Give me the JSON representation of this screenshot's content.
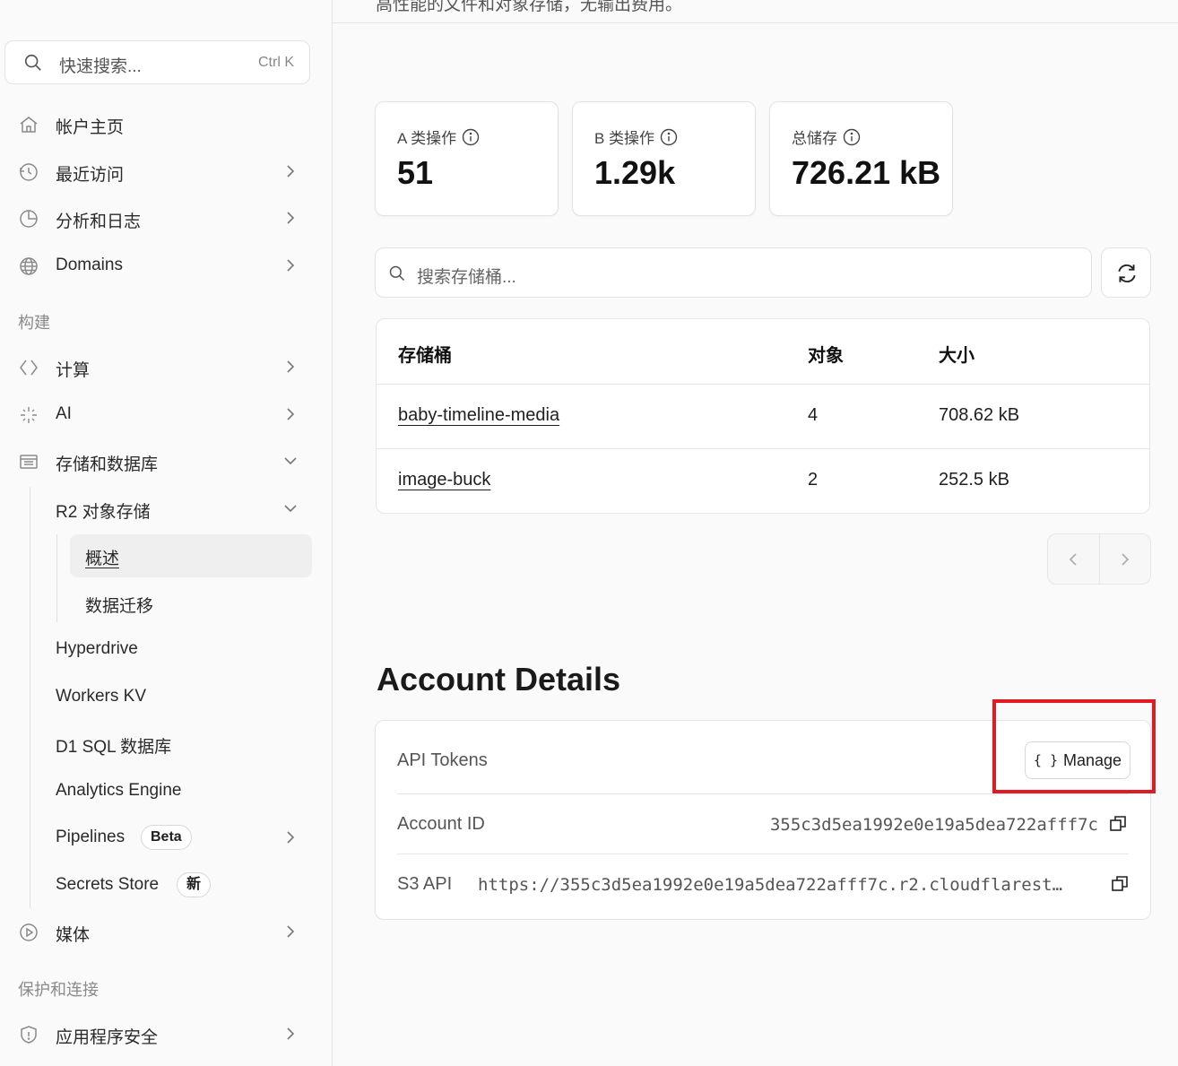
{
  "sidebar": {
    "search": {
      "placeholder": "快速搜索...",
      "shortcut": "Ctrl K"
    },
    "top_items": [
      {
        "label": "帐户主页",
        "icon": "home-icon"
      },
      {
        "label": "最近访问",
        "icon": "history-icon"
      },
      {
        "label": "分析和日志",
        "icon": "pie-chart-icon"
      },
      {
        "label": "Domains",
        "icon": "globe-icon"
      }
    ],
    "section_build": "构建",
    "build_items": [
      {
        "label": "计算",
        "icon": "code-diamond-icon"
      },
      {
        "label": "AI",
        "icon": "sparkles-icon"
      },
      {
        "label": "存储和数据库",
        "icon": "storage-icon"
      }
    ],
    "r2_label": "R2 对象存储",
    "r2_sub": [
      "概述",
      "数据迁移"
    ],
    "storage_sub": [
      "Hyperdrive",
      "Workers KV",
      "D1 SQL 数据库",
      "Analytics Engine",
      "Pipelines",
      "Secrets Store"
    ],
    "badges": {
      "pipelines": "Beta",
      "secrets": "新"
    },
    "media_label": "媒体",
    "section_protect": "保护和连接",
    "app_security_label": "应用程序安全"
  },
  "main": {
    "top_text": "高性能的文件和对象存储，无输出费用。",
    "stats": [
      {
        "title": "A 类操作",
        "value": "51"
      },
      {
        "title": "B 类操作",
        "value": "1.29k"
      },
      {
        "title": "总储存",
        "value": "726.21 kB"
      }
    ],
    "bucket_search_placeholder": "搜索存储桶...",
    "table": {
      "headers": [
        "存储桶",
        "对象",
        "大小"
      ],
      "rows": [
        {
          "name": "baby-timeline-media",
          "objects": "4",
          "size": "708.62 kB"
        },
        {
          "name": "image-buck",
          "objects": "2",
          "size": "252.5 kB"
        }
      ]
    },
    "account_details": {
      "title": "Account Details",
      "api_tokens_label": "API Tokens",
      "manage_label": "Manage",
      "account_id_label": "Account ID",
      "account_id_value": "355c3d5ea1992e0e19a5dea722afff7c",
      "s3_label": "S3 API",
      "s3_value": "https://355c3d5ea1992e0e19a5dea722afff7c.r2.cloudflarest…"
    }
  },
  "colors": {
    "highlight": "#e01b24",
    "border": "#e3e3e3"
  }
}
